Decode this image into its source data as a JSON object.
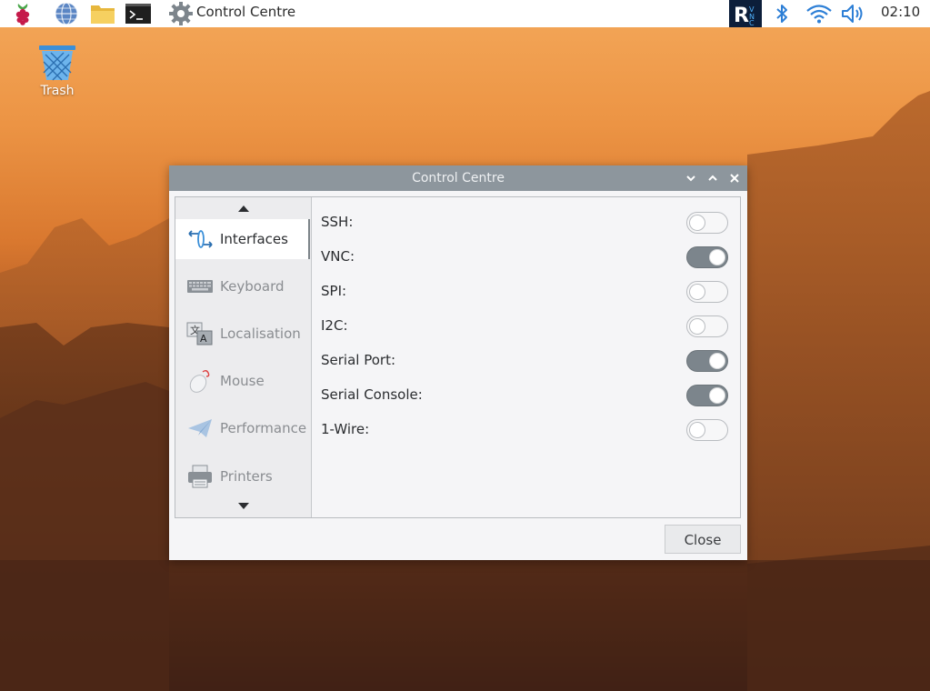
{
  "taskbar": {
    "active_app_title": "Control Centre",
    "clock": "02:10",
    "launchers": [
      "raspberry-menu-icon",
      "web-browser-icon",
      "file-manager-icon",
      "terminal-icon",
      "control-centre-gear-icon"
    ],
    "tray": [
      "vnc-icon",
      "bluetooth-icon",
      "wifi-icon",
      "volume-icon"
    ]
  },
  "desktop": {
    "trash_label": "Trash"
  },
  "window": {
    "title": "Control Centre",
    "controls": [
      "minimize",
      "maximize",
      "close"
    ],
    "sidebar": {
      "items": [
        {
          "label": "Interfaces",
          "icon": "interfaces-icon",
          "active": true
        },
        {
          "label": "Keyboard",
          "icon": "keyboard-icon",
          "active": false
        },
        {
          "label": "Localisation",
          "icon": "localisation-icon",
          "active": false
        },
        {
          "label": "Mouse",
          "icon": "mouse-icon",
          "active": false
        },
        {
          "label": "Performance",
          "icon": "performance-icon",
          "active": false
        },
        {
          "label": "Printers",
          "icon": "printer-icon",
          "active": false
        }
      ]
    },
    "settings": [
      {
        "label": "SSH:",
        "enabled": false
      },
      {
        "label": "VNC:",
        "enabled": true
      },
      {
        "label": "SPI:",
        "enabled": false
      },
      {
        "label": "I2C:",
        "enabled": false
      },
      {
        "label": "Serial Port:",
        "enabled": true
      },
      {
        "label": "Serial Console:",
        "enabled": true
      },
      {
        "label": "1-Wire:",
        "enabled": false
      }
    ],
    "close_label": "Close"
  },
  "colors": {
    "accent_toggle_on": "#7c858c",
    "titlebar": "#8d969d",
    "taskbar": "#ffffff"
  }
}
